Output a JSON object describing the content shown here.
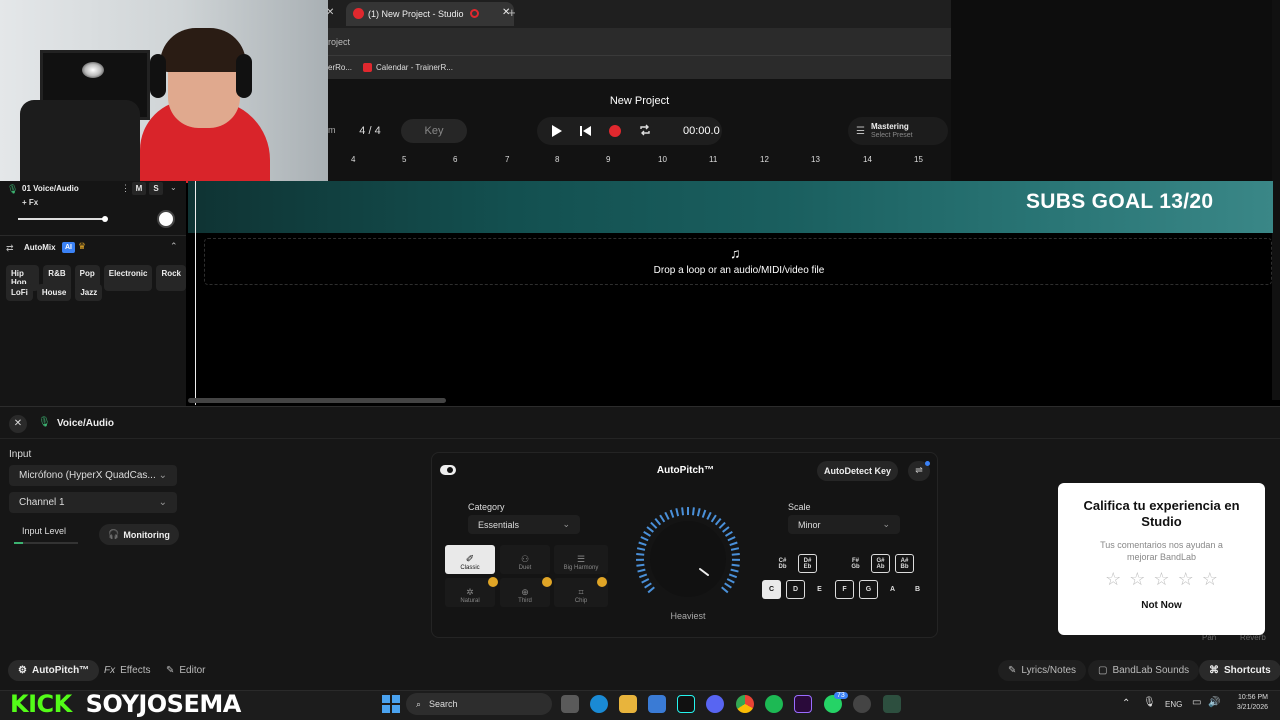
{
  "browser": {
    "tab_title": "(1) New Project - Studio",
    "address_text": "roject",
    "bookmarks": [
      "erRo...",
      "Calendar - TrainerR..."
    ]
  },
  "studio": {
    "project_title": "New Project",
    "time_signature": "4 / 4",
    "time_sig_left": "m",
    "key_label": "Key",
    "time_display": "00:00.0",
    "mastering_label": "Mastering",
    "select_preset": "Select Preset",
    "ruler": [
      "4",
      "5",
      "6",
      "7",
      "8",
      "9",
      "10",
      "11",
      "12",
      "13",
      "14",
      "15"
    ],
    "drop_text": "Drop a loop or an audio/MIDI/video file"
  },
  "overlay": {
    "subs_goal": "SUBS GOAL 13/20",
    "kick": "KICK",
    "channel": "SOYJOSEMA"
  },
  "track": {
    "name": "01  Voice/Audio",
    "mute": "M",
    "solo": "S",
    "fx": "+ Fx"
  },
  "automix": {
    "label": "AutoMix",
    "badge": "AI",
    "genres_row1": [
      "Hip Hop",
      "R&B",
      "Pop",
      "Electronic",
      "Rock"
    ],
    "genres_row2": [
      "LoFi",
      "House",
      "Jazz"
    ]
  },
  "editor": {
    "title": "Voice/Audio",
    "input_label": "Input",
    "input_device": "Micrófono (HyperX QuadCas...",
    "channel": "Channel 1",
    "input_level_label": "Input Level",
    "input_level": 0.14,
    "monitoring": "Monitoring"
  },
  "autopitch": {
    "title": "AutoPitch™",
    "enabled": true,
    "autodetect": "AutoDetect Key",
    "category_label": "Category",
    "category_value": "Essentials",
    "scale_label": "Scale",
    "scale_value": "Minor",
    "knob_label": "Heaviest",
    "knob_value": 1.0,
    "modes": [
      {
        "label": "Classic",
        "selected": true,
        "premium": false
      },
      {
        "label": "Duet",
        "selected": false,
        "premium": false
      },
      {
        "label": "Big Harmony",
        "selected": false,
        "premium": false
      },
      {
        "label": "Natural",
        "selected": false,
        "premium": true
      },
      {
        "label": "Third",
        "selected": false,
        "premium": true
      },
      {
        "label": "Chip",
        "selected": false,
        "premium": true
      }
    ],
    "sharps": [
      {
        "top": "C#",
        "bottom": "Db",
        "outlined": false
      },
      {
        "top": "D#",
        "bottom": "Eb",
        "outlined": true
      },
      {
        "top": "F#",
        "bottom": "Gb",
        "outlined": false
      },
      {
        "top": "G#",
        "bottom": "Ab",
        "outlined": true
      },
      {
        "top": "A#",
        "bottom": "Bb",
        "outlined": true
      }
    ],
    "naturals": [
      {
        "label": "C",
        "state": "active"
      },
      {
        "label": "D",
        "state": "outlined"
      },
      {
        "label": "E",
        "state": "plain"
      },
      {
        "label": "F",
        "state": "outlined"
      },
      {
        "label": "G",
        "state": "outlined"
      },
      {
        "label": "A",
        "state": "plain"
      },
      {
        "label": "B",
        "state": "plain"
      }
    ]
  },
  "rating": {
    "title": "Califica tu experiencia en Studio",
    "subtitle": "Tus comentarios nos ayudan a mejorar BandLab",
    "stars": 5,
    "not_now": "Not Now",
    "behind_left": "Pan",
    "behind_right": "Reverb"
  },
  "bottom_tabs": {
    "autopitch": "AutoPitch™",
    "effects": "Effects",
    "editor": "Editor",
    "lyrics": "Lyrics/Notes",
    "sounds": "BandLab Sounds",
    "shortcuts": "Shortcuts"
  },
  "taskbar": {
    "search": "Search",
    "lang": "ENG",
    "time": "10:56 PM",
    "date": "3/21/2026",
    "badge_count": "73"
  },
  "colors": {
    "accent_red": "#e0282e",
    "teal": "#1a5f5f",
    "knob_blue": "#4a90d9",
    "kick_green": "#53fc18"
  }
}
